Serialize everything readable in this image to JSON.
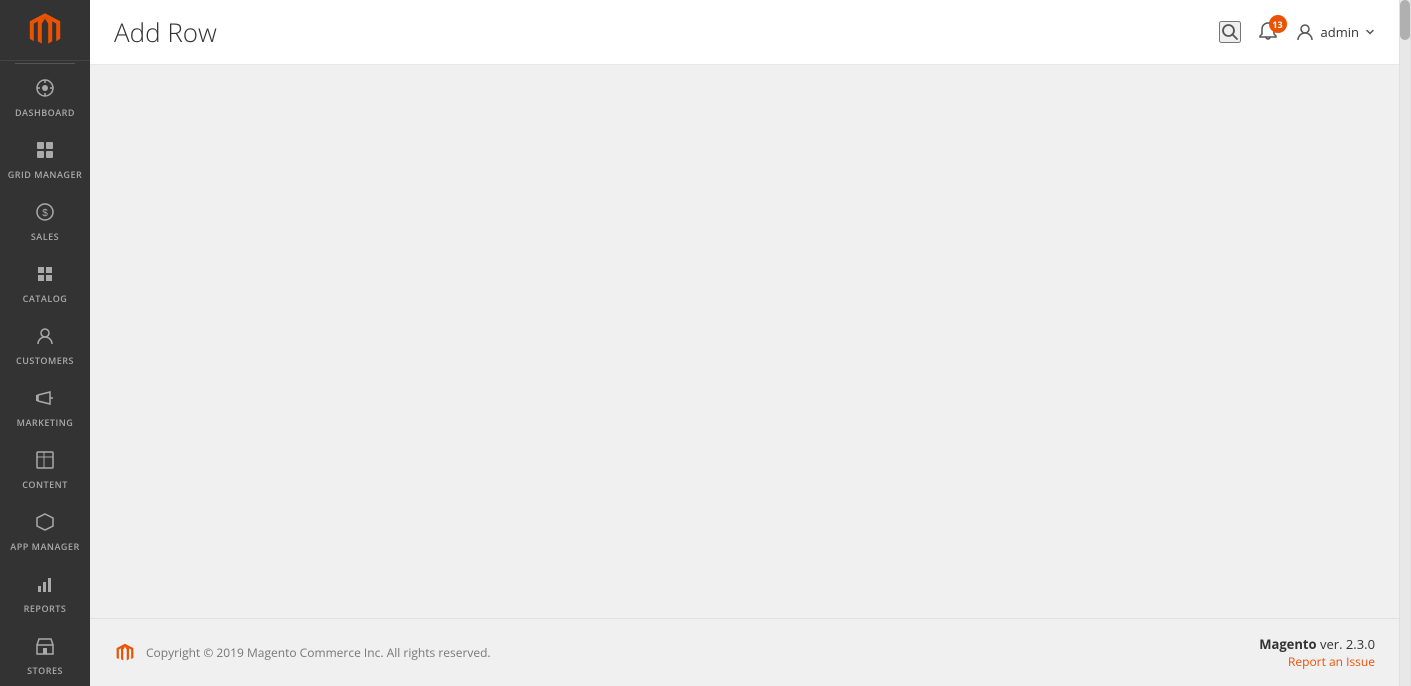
{
  "sidebar": {
    "logo_alt": "Magento Logo",
    "items": [
      {
        "id": "dashboard",
        "label": "DASHBOARD",
        "icon": "⊙"
      },
      {
        "id": "grid-manager",
        "label": "GRID MANAGER",
        "icon": "⊞"
      },
      {
        "id": "sales",
        "label": "SALES",
        "icon": "$"
      },
      {
        "id": "catalog",
        "label": "CATALOG",
        "icon": "◫"
      },
      {
        "id": "customers",
        "label": "CUSTOMERS",
        "icon": "👤"
      },
      {
        "id": "marketing",
        "label": "MARKETING",
        "icon": "📢"
      },
      {
        "id": "content",
        "label": "CONTENT",
        "icon": "▦"
      },
      {
        "id": "app-manager",
        "label": "APP MANAGER",
        "icon": "⬡"
      },
      {
        "id": "reports",
        "label": "REPORTS",
        "icon": "📊"
      },
      {
        "id": "stores",
        "label": "STORES",
        "icon": "🏪"
      }
    ]
  },
  "header": {
    "page_title": "Add Row",
    "notification_count": "13",
    "user_name": "admin"
  },
  "footer": {
    "copyright": "Copyright © 2019 Magento Commerce Inc. All rights reserved.",
    "version_label": "Magento",
    "version_number": "ver. 2.3.0",
    "report_link": "Report an Issue"
  },
  "colors": {
    "accent": "#eb5202",
    "sidebar_bg": "#333333",
    "header_bg": "#ffffff",
    "content_bg": "#f0f0f0"
  }
}
